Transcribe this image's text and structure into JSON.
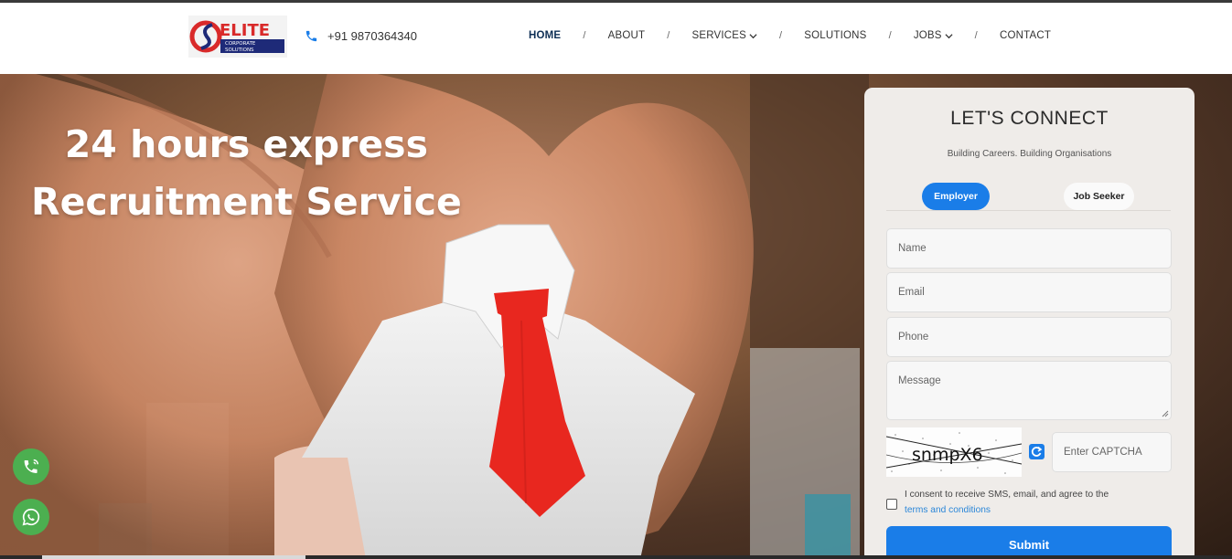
{
  "header": {
    "logo_text": "ELITE",
    "logo_subtext": "CORPORATE SOLUTIONS",
    "logo_monogram": "CS",
    "phone": "+91 9870364340",
    "nav": [
      {
        "label": "HOME",
        "active": true,
        "dropdown": false
      },
      {
        "label": "ABOUT",
        "active": false,
        "dropdown": false
      },
      {
        "label": "SERVICES",
        "active": false,
        "dropdown": true
      },
      {
        "label": "SOLUTIONS",
        "active": false,
        "dropdown": false
      },
      {
        "label": "JOBS",
        "active": false,
        "dropdown": true
      },
      {
        "label": "CONTACT",
        "active": false,
        "dropdown": false
      }
    ],
    "nav_separator": "/"
  },
  "hero": {
    "title_line1": "24 hours express",
    "title_line2": "Recruitment Service"
  },
  "form": {
    "title": "LET'S CONNECT",
    "subtitle": "Building Careers. Building Organisations",
    "tabs": [
      {
        "label": "Employer",
        "active": true
      },
      {
        "label": "Job Seeker",
        "active": false
      }
    ],
    "name_placeholder": "Name",
    "email_placeholder": "Email",
    "phone_placeholder": "Phone",
    "message_placeholder": "Message",
    "captcha_text": "snmpX6",
    "captcha_placeholder": "Enter CAPTCHA",
    "consent_text": "I consent to receive SMS, email, and agree to the",
    "consent_link": "terms and conditions",
    "submit_label": "Submit"
  },
  "floating": {
    "call_icon": "phone-call-icon",
    "whatsapp_icon": "whatsapp-icon"
  },
  "colors": {
    "accent": "#1a7de8",
    "nav_active": "#0e2f55",
    "fab_green": "#4caf50",
    "logo_red": "#d92a2a",
    "logo_navy": "#1e2a78"
  }
}
